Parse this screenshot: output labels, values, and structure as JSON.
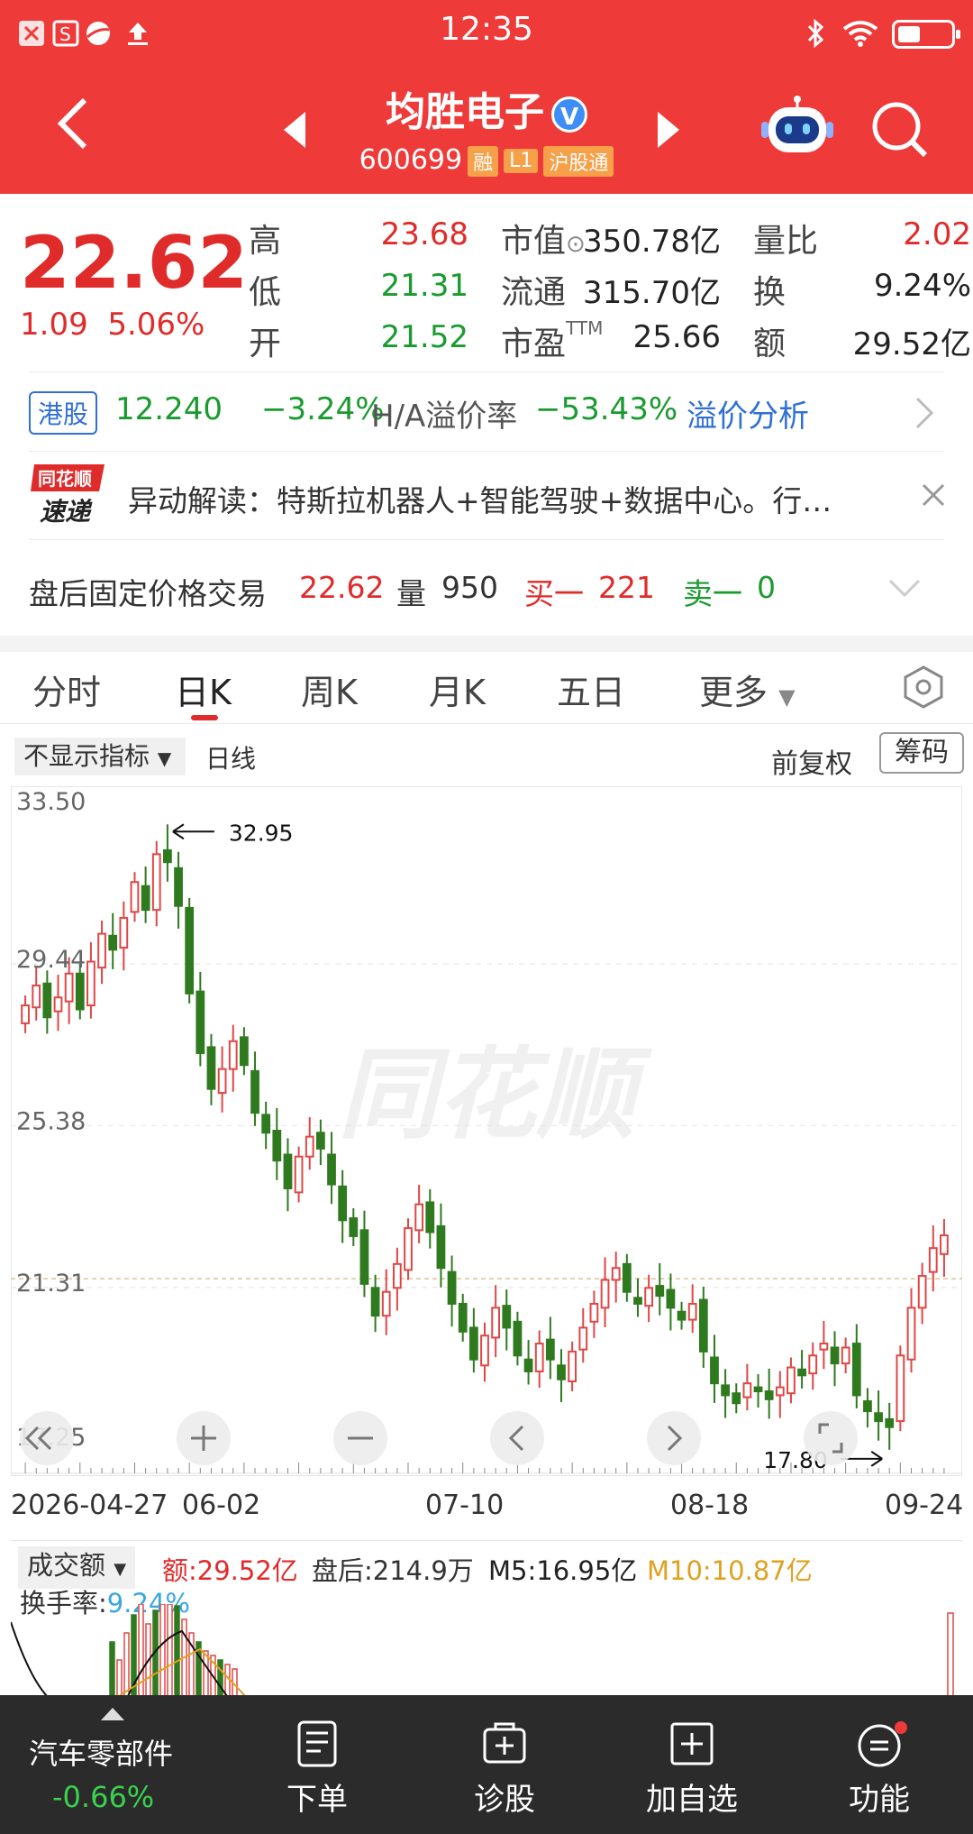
{
  "status_bar": {
    "time": "12:35"
  },
  "header": {
    "stock_name": "均胜电子",
    "stock_code": "600699",
    "tags": [
      "融",
      "L1",
      "沪股通"
    ]
  },
  "quote": {
    "price": "22.62",
    "change": "1.09",
    "change_pct": "5.06%",
    "rows": [
      {
        "l1": "高",
        "v1": "23.68",
        "l2": "市值",
        "v2": "350.78亿",
        "l3": "量比",
        "v3": "2.02"
      },
      {
        "l1": "低",
        "v1": "21.31",
        "l2": "流通",
        "v2": "315.70亿",
        "l3": "换",
        "v3": "9.24%"
      },
      {
        "l1": "开",
        "v1": "21.52",
        "l2": "市盈TTM",
        "v2": "25.66",
        "l3": "额",
        "v3": "29.52亿"
      }
    ]
  },
  "hk": {
    "tag": "港股",
    "price": "12.240",
    "pct": "−3.24%",
    "premium_label": "H/A溢价率",
    "premium": "−53.43%",
    "link": "溢价分析"
  },
  "news": {
    "logo_top": "同花顺",
    "logo_bottom": "速递",
    "text": "异动解读：特斯拉机器人+智能驾驶+数据中心。行…"
  },
  "after_hours": {
    "label": "盘后固定价格交易",
    "price": "22.62",
    "vol_label": "量",
    "vol": "950",
    "buy_label": "买一",
    "buy": "221",
    "sell_label": "卖一",
    "sell": "0"
  },
  "tabs": [
    "分时",
    "日K",
    "周K",
    "月K",
    "五日",
    "更多"
  ],
  "chart_toolbar": {
    "indicator": "不显示指标",
    "mode": "日线",
    "adjust": "前复权",
    "chips": "筹码"
  },
  "chart_data": {
    "type": "candlestick",
    "watermark": "同花顺",
    "y_ticks": [
      "33.50",
      "29.44",
      "25.38",
      "21.31",
      "17.25"
    ],
    "ylim": [
      17.25,
      33.5
    ],
    "x_ticks": [
      "2026-04-27",
      "06-02",
      "07-10",
      "08-18",
      "09-24"
    ],
    "annotations": {
      "high": "32.95",
      "low": "17.80"
    },
    "reference_price": 21.53,
    "closes": [
      28.4,
      28.9,
      28.1,
      28.6,
      29.2,
      28.3,
      29.5,
      30.2,
      29.8,
      30.6,
      31.5,
      30.8,
      32.2,
      32.0,
      30.9,
      28.7,
      27.2,
      26.3,
      26.8,
      27.5,
      26.9,
      25.7,
      25.2,
      24.5,
      23.8,
      24.6,
      25.1,
      24.8,
      23.9,
      23.0,
      22.6,
      21.4,
      20.6,
      21.2,
      21.9,
      22.8,
      23.4,
      22.7,
      21.8,
      20.9,
      20.2,
      19.5,
      20.1,
      20.8,
      20.3,
      19.6,
      19.2,
      19.9,
      19.5,
      19.0,
      19.7,
      20.3,
      20.9,
      21.5,
      21.8,
      21.2,
      20.9,
      21.3,
      21.1,
      20.8,
      20.5,
      20.9,
      19.7,
      18.9,
      18.6,
      18.4,
      18.9,
      18.7,
      18.5,
      18.8,
      19.3,
      19.1,
      19.6,
      19.9,
      19.4,
      19.8,
      18.6,
      18.2,
      17.95,
      17.8,
      19.6,
      20.8,
      21.6,
      22.3,
      22.62
    ],
    "volume_bar": {
      "label": "成交额",
      "amount": "额:29.52亿",
      "after": "盘后:214.9万",
      "m5": "M5:16.95亿",
      "m10": "M10:10.87亿",
      "turnover_label": "换手率:",
      "turnover": "9.24%"
    }
  },
  "bottom_nav": {
    "sector": "汽车零部件",
    "sector_pct": "-0.66%",
    "items": [
      "下单",
      "诊股",
      "加自选",
      "功能"
    ]
  }
}
